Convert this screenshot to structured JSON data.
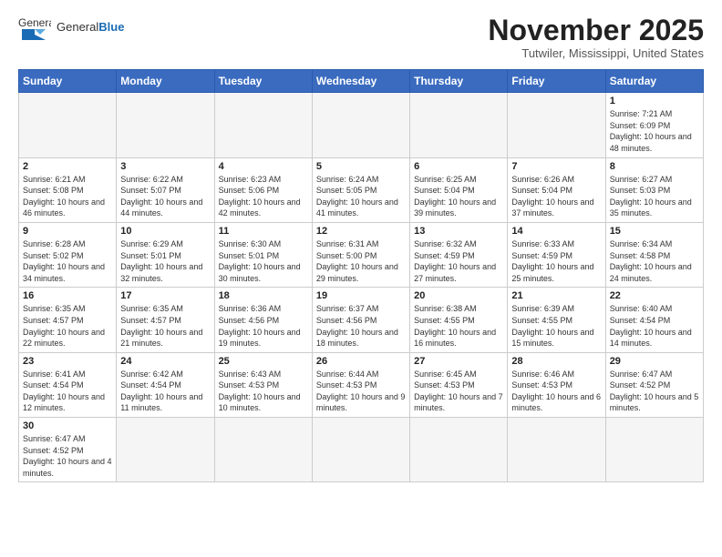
{
  "header": {
    "logo_general": "General",
    "logo_blue": "Blue",
    "title": "November 2025",
    "subtitle": "Tutwiler, Mississippi, United States"
  },
  "weekdays": [
    "Sunday",
    "Monday",
    "Tuesday",
    "Wednesday",
    "Thursday",
    "Friday",
    "Saturday"
  ],
  "weeks": [
    [
      {
        "day": "",
        "info": ""
      },
      {
        "day": "",
        "info": ""
      },
      {
        "day": "",
        "info": ""
      },
      {
        "day": "",
        "info": ""
      },
      {
        "day": "",
        "info": ""
      },
      {
        "day": "",
        "info": ""
      },
      {
        "day": "1",
        "info": "Sunrise: 7:21 AM\nSunset: 6:09 PM\nDaylight: 10 hours and 48 minutes."
      }
    ],
    [
      {
        "day": "2",
        "info": "Sunrise: 6:21 AM\nSunset: 5:08 PM\nDaylight: 10 hours and 46 minutes."
      },
      {
        "day": "3",
        "info": "Sunrise: 6:22 AM\nSunset: 5:07 PM\nDaylight: 10 hours and 44 minutes."
      },
      {
        "day": "4",
        "info": "Sunrise: 6:23 AM\nSunset: 5:06 PM\nDaylight: 10 hours and 42 minutes."
      },
      {
        "day": "5",
        "info": "Sunrise: 6:24 AM\nSunset: 5:05 PM\nDaylight: 10 hours and 41 minutes."
      },
      {
        "day": "6",
        "info": "Sunrise: 6:25 AM\nSunset: 5:04 PM\nDaylight: 10 hours and 39 minutes."
      },
      {
        "day": "7",
        "info": "Sunrise: 6:26 AM\nSunset: 5:04 PM\nDaylight: 10 hours and 37 minutes."
      },
      {
        "day": "8",
        "info": "Sunrise: 6:27 AM\nSunset: 5:03 PM\nDaylight: 10 hours and 35 minutes."
      }
    ],
    [
      {
        "day": "9",
        "info": "Sunrise: 6:28 AM\nSunset: 5:02 PM\nDaylight: 10 hours and 34 minutes."
      },
      {
        "day": "10",
        "info": "Sunrise: 6:29 AM\nSunset: 5:01 PM\nDaylight: 10 hours and 32 minutes."
      },
      {
        "day": "11",
        "info": "Sunrise: 6:30 AM\nSunset: 5:01 PM\nDaylight: 10 hours and 30 minutes."
      },
      {
        "day": "12",
        "info": "Sunrise: 6:31 AM\nSunset: 5:00 PM\nDaylight: 10 hours and 29 minutes."
      },
      {
        "day": "13",
        "info": "Sunrise: 6:32 AM\nSunset: 4:59 PM\nDaylight: 10 hours and 27 minutes."
      },
      {
        "day": "14",
        "info": "Sunrise: 6:33 AM\nSunset: 4:59 PM\nDaylight: 10 hours and 25 minutes."
      },
      {
        "day": "15",
        "info": "Sunrise: 6:34 AM\nSunset: 4:58 PM\nDaylight: 10 hours and 24 minutes."
      }
    ],
    [
      {
        "day": "16",
        "info": "Sunrise: 6:35 AM\nSunset: 4:57 PM\nDaylight: 10 hours and 22 minutes."
      },
      {
        "day": "17",
        "info": "Sunrise: 6:35 AM\nSunset: 4:57 PM\nDaylight: 10 hours and 21 minutes."
      },
      {
        "day": "18",
        "info": "Sunrise: 6:36 AM\nSunset: 4:56 PM\nDaylight: 10 hours and 19 minutes."
      },
      {
        "day": "19",
        "info": "Sunrise: 6:37 AM\nSunset: 4:56 PM\nDaylight: 10 hours and 18 minutes."
      },
      {
        "day": "20",
        "info": "Sunrise: 6:38 AM\nSunset: 4:55 PM\nDaylight: 10 hours and 16 minutes."
      },
      {
        "day": "21",
        "info": "Sunrise: 6:39 AM\nSunset: 4:55 PM\nDaylight: 10 hours and 15 minutes."
      },
      {
        "day": "22",
        "info": "Sunrise: 6:40 AM\nSunset: 4:54 PM\nDaylight: 10 hours and 14 minutes."
      }
    ],
    [
      {
        "day": "23",
        "info": "Sunrise: 6:41 AM\nSunset: 4:54 PM\nDaylight: 10 hours and 12 minutes."
      },
      {
        "day": "24",
        "info": "Sunrise: 6:42 AM\nSunset: 4:54 PM\nDaylight: 10 hours and 11 minutes."
      },
      {
        "day": "25",
        "info": "Sunrise: 6:43 AM\nSunset: 4:53 PM\nDaylight: 10 hours and 10 minutes."
      },
      {
        "day": "26",
        "info": "Sunrise: 6:44 AM\nSunset: 4:53 PM\nDaylight: 10 hours and 9 minutes."
      },
      {
        "day": "27",
        "info": "Sunrise: 6:45 AM\nSunset: 4:53 PM\nDaylight: 10 hours and 7 minutes."
      },
      {
        "day": "28",
        "info": "Sunrise: 6:46 AM\nSunset: 4:53 PM\nDaylight: 10 hours and 6 minutes."
      },
      {
        "day": "29",
        "info": "Sunrise: 6:47 AM\nSunset: 4:52 PM\nDaylight: 10 hours and 5 minutes."
      }
    ],
    [
      {
        "day": "30",
        "info": "Sunrise: 6:47 AM\nSunset: 4:52 PM\nDaylight: 10 hours and 4 minutes."
      },
      {
        "day": "",
        "info": ""
      },
      {
        "day": "",
        "info": ""
      },
      {
        "day": "",
        "info": ""
      },
      {
        "day": "",
        "info": ""
      },
      {
        "day": "",
        "info": ""
      },
      {
        "day": "",
        "info": ""
      }
    ]
  ]
}
